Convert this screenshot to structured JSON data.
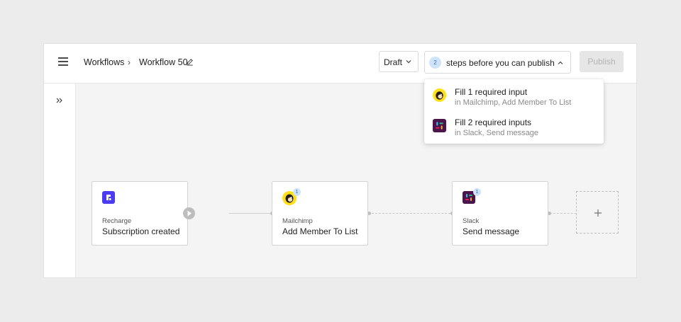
{
  "header": {
    "breadcrumb_root": "Workflows",
    "breadcrumb_separator": "›",
    "workflow_name": "Workflow 50",
    "status_select": "Draft",
    "steps_count": "2",
    "steps_label": "steps before you can publish",
    "publish_label": "Publish"
  },
  "dropdown": {
    "items": [
      {
        "title": "Fill 1 required input",
        "subtitle": "in Mailchimp, Add Member To List",
        "icon": "mailchimp-icon"
      },
      {
        "title": "Fill 2 required inputs",
        "subtitle": "in Slack, Send message",
        "icon": "slack-icon"
      }
    ]
  },
  "nodes": [
    {
      "app": "Recharge",
      "action": "Subscription created",
      "icon": "recharge-icon",
      "badge": ""
    },
    {
      "app": "Mailchimp",
      "action": "Add Member To List",
      "icon": "mailchimp-icon",
      "badge": "1"
    },
    {
      "app": "Slack",
      "action": "Send message",
      "icon": "slack-icon",
      "badge": "1"
    }
  ],
  "colors": {
    "recharge": "#4b3bf5",
    "mailchimp": "#ffe01b",
    "slack": "#4a154b",
    "badge_bg": "#cfe3fb",
    "publish_disabled": "#e6e6e6"
  }
}
